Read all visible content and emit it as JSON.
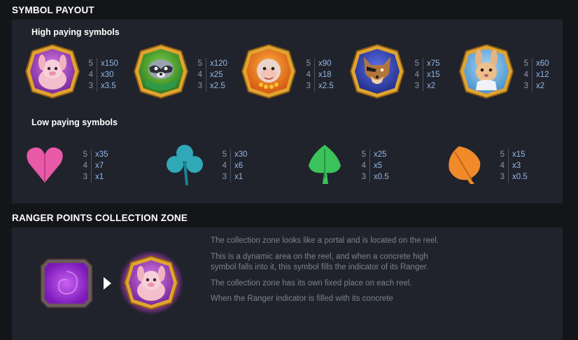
{
  "sections": {
    "payout_title": "SYMBOL PAYOUT",
    "high_title": "High paying symbols",
    "low_title": "Low paying symbols",
    "zone_title": "RANGER POINTS COLLECTION ZONE"
  },
  "high_symbols": [
    {
      "icon": "sheep-icon",
      "pays": [
        {
          "n": "5",
          "v": "x150"
        },
        {
          "n": "4",
          "v": "x30"
        },
        {
          "n": "3",
          "v": "x3.5"
        }
      ]
    },
    {
      "icon": "raccoon-icon",
      "pays": [
        {
          "n": "5",
          "v": "x120"
        },
        {
          "n": "4",
          "v": "x25"
        },
        {
          "n": "3",
          "v": "x2.5"
        }
      ]
    },
    {
      "icon": "monkey-icon",
      "pays": [
        {
          "n": "5",
          "v": "x90"
        },
        {
          "n": "4",
          "v": "x18"
        },
        {
          "n": "3",
          "v": "x2.5"
        }
      ]
    },
    {
      "icon": "wolf-icon",
      "pays": [
        {
          "n": "5",
          "v": "x75"
        },
        {
          "n": "4",
          "v": "x15"
        },
        {
          "n": "3",
          "v": "x2"
        }
      ]
    },
    {
      "icon": "rabbit-icon",
      "pays": [
        {
          "n": "5",
          "v": "x60"
        },
        {
          "n": "4",
          "v": "x12"
        },
        {
          "n": "3",
          "v": "x2"
        }
      ]
    }
  ],
  "low_symbols": [
    {
      "icon": "heart-leaf-icon",
      "color": "#e85aa8",
      "pays": [
        {
          "n": "5",
          "v": "x35"
        },
        {
          "n": "4",
          "v": "x7"
        },
        {
          "n": "3",
          "v": "x1"
        }
      ]
    },
    {
      "icon": "clover-leaf-icon",
      "color": "#2fa9b8",
      "pays": [
        {
          "n": "5",
          "v": "x30"
        },
        {
          "n": "4",
          "v": "x6"
        },
        {
          "n": "3",
          "v": "x1"
        }
      ]
    },
    {
      "icon": "spade-leaf-icon",
      "color": "#3cc25a",
      "pays": [
        {
          "n": "5",
          "v": "x25"
        },
        {
          "n": "4",
          "v": "x5"
        },
        {
          "n": "3",
          "v": "x0.5"
        }
      ]
    },
    {
      "icon": "autumn-leaf-icon",
      "color": "#f08a2a",
      "pays": [
        {
          "n": "5",
          "v": "x15"
        },
        {
          "n": "4",
          "v": "x3"
        },
        {
          "n": "3",
          "v": "x0.5"
        }
      ]
    }
  ],
  "zone": {
    "portal_icon": "portal-icon",
    "filled_icon": "sheep-glow-icon",
    "paragraphs": [
      "The collection zone looks like a portal and is located on the reel.",
      "This is a dynamic area on the reel, and when a concrete high symbol falls into it, this symbol fills the indicator of its Ranger.",
      "The collection zone has its own fixed place on each reel.",
      "When the Ranger indicator is filled with its concrete"
    ]
  },
  "colors": {
    "background": "#141519",
    "panel": "#20232c",
    "pay_value": "#93b7e6",
    "gold_frame": "#e0a431"
  }
}
